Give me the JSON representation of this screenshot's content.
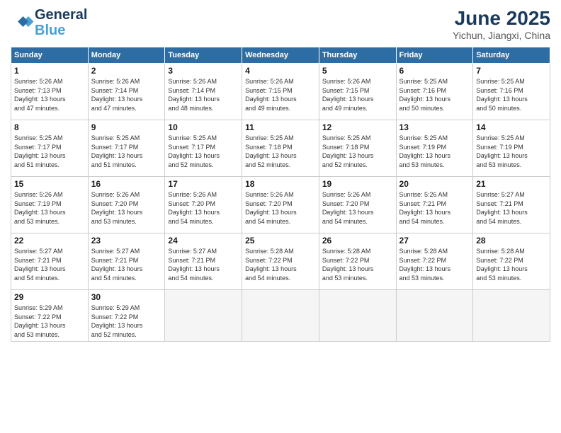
{
  "logo": {
    "line1": "General",
    "line2": "Blue"
  },
  "header": {
    "title": "June 2025",
    "location": "Yichun, Jiangxi, China"
  },
  "weekdays": [
    "Sunday",
    "Monday",
    "Tuesday",
    "Wednesday",
    "Thursday",
    "Friday",
    "Saturday"
  ],
  "weeks": [
    [
      {
        "day": "1",
        "info": "Sunrise: 5:26 AM\nSunset: 7:13 PM\nDaylight: 13 hours\nand 47 minutes."
      },
      {
        "day": "2",
        "info": "Sunrise: 5:26 AM\nSunset: 7:14 PM\nDaylight: 13 hours\nand 47 minutes."
      },
      {
        "day": "3",
        "info": "Sunrise: 5:26 AM\nSunset: 7:14 PM\nDaylight: 13 hours\nand 48 minutes."
      },
      {
        "day": "4",
        "info": "Sunrise: 5:26 AM\nSunset: 7:15 PM\nDaylight: 13 hours\nand 49 minutes."
      },
      {
        "day": "5",
        "info": "Sunrise: 5:26 AM\nSunset: 7:15 PM\nDaylight: 13 hours\nand 49 minutes."
      },
      {
        "day": "6",
        "info": "Sunrise: 5:25 AM\nSunset: 7:16 PM\nDaylight: 13 hours\nand 50 minutes."
      },
      {
        "day": "7",
        "info": "Sunrise: 5:25 AM\nSunset: 7:16 PM\nDaylight: 13 hours\nand 50 minutes."
      }
    ],
    [
      {
        "day": "8",
        "info": "Sunrise: 5:25 AM\nSunset: 7:17 PM\nDaylight: 13 hours\nand 51 minutes."
      },
      {
        "day": "9",
        "info": "Sunrise: 5:25 AM\nSunset: 7:17 PM\nDaylight: 13 hours\nand 51 minutes."
      },
      {
        "day": "10",
        "info": "Sunrise: 5:25 AM\nSunset: 7:17 PM\nDaylight: 13 hours\nand 52 minutes."
      },
      {
        "day": "11",
        "info": "Sunrise: 5:25 AM\nSunset: 7:18 PM\nDaylight: 13 hours\nand 52 minutes."
      },
      {
        "day": "12",
        "info": "Sunrise: 5:25 AM\nSunset: 7:18 PM\nDaylight: 13 hours\nand 52 minutes."
      },
      {
        "day": "13",
        "info": "Sunrise: 5:25 AM\nSunset: 7:19 PM\nDaylight: 13 hours\nand 53 minutes."
      },
      {
        "day": "14",
        "info": "Sunrise: 5:25 AM\nSunset: 7:19 PM\nDaylight: 13 hours\nand 53 minutes."
      }
    ],
    [
      {
        "day": "15",
        "info": "Sunrise: 5:26 AM\nSunset: 7:19 PM\nDaylight: 13 hours\nand 53 minutes."
      },
      {
        "day": "16",
        "info": "Sunrise: 5:26 AM\nSunset: 7:20 PM\nDaylight: 13 hours\nand 53 minutes."
      },
      {
        "day": "17",
        "info": "Sunrise: 5:26 AM\nSunset: 7:20 PM\nDaylight: 13 hours\nand 54 minutes."
      },
      {
        "day": "18",
        "info": "Sunrise: 5:26 AM\nSunset: 7:20 PM\nDaylight: 13 hours\nand 54 minutes."
      },
      {
        "day": "19",
        "info": "Sunrise: 5:26 AM\nSunset: 7:20 PM\nDaylight: 13 hours\nand 54 minutes."
      },
      {
        "day": "20",
        "info": "Sunrise: 5:26 AM\nSunset: 7:21 PM\nDaylight: 13 hours\nand 54 minutes."
      },
      {
        "day": "21",
        "info": "Sunrise: 5:27 AM\nSunset: 7:21 PM\nDaylight: 13 hours\nand 54 minutes."
      }
    ],
    [
      {
        "day": "22",
        "info": "Sunrise: 5:27 AM\nSunset: 7:21 PM\nDaylight: 13 hours\nand 54 minutes."
      },
      {
        "day": "23",
        "info": "Sunrise: 5:27 AM\nSunset: 7:21 PM\nDaylight: 13 hours\nand 54 minutes."
      },
      {
        "day": "24",
        "info": "Sunrise: 5:27 AM\nSunset: 7:21 PM\nDaylight: 13 hours\nand 54 minutes."
      },
      {
        "day": "25",
        "info": "Sunrise: 5:28 AM\nSunset: 7:22 PM\nDaylight: 13 hours\nand 54 minutes."
      },
      {
        "day": "26",
        "info": "Sunrise: 5:28 AM\nSunset: 7:22 PM\nDaylight: 13 hours\nand 53 minutes."
      },
      {
        "day": "27",
        "info": "Sunrise: 5:28 AM\nSunset: 7:22 PM\nDaylight: 13 hours\nand 53 minutes."
      },
      {
        "day": "28",
        "info": "Sunrise: 5:28 AM\nSunset: 7:22 PM\nDaylight: 13 hours\nand 53 minutes."
      }
    ],
    [
      {
        "day": "29",
        "info": "Sunrise: 5:29 AM\nSunset: 7:22 PM\nDaylight: 13 hours\nand 53 minutes."
      },
      {
        "day": "30",
        "info": "Sunrise: 5:29 AM\nSunset: 7:22 PM\nDaylight: 13 hours\nand 52 minutes."
      },
      {
        "day": "",
        "info": ""
      },
      {
        "day": "",
        "info": ""
      },
      {
        "day": "",
        "info": ""
      },
      {
        "day": "",
        "info": ""
      },
      {
        "day": "",
        "info": ""
      }
    ]
  ]
}
